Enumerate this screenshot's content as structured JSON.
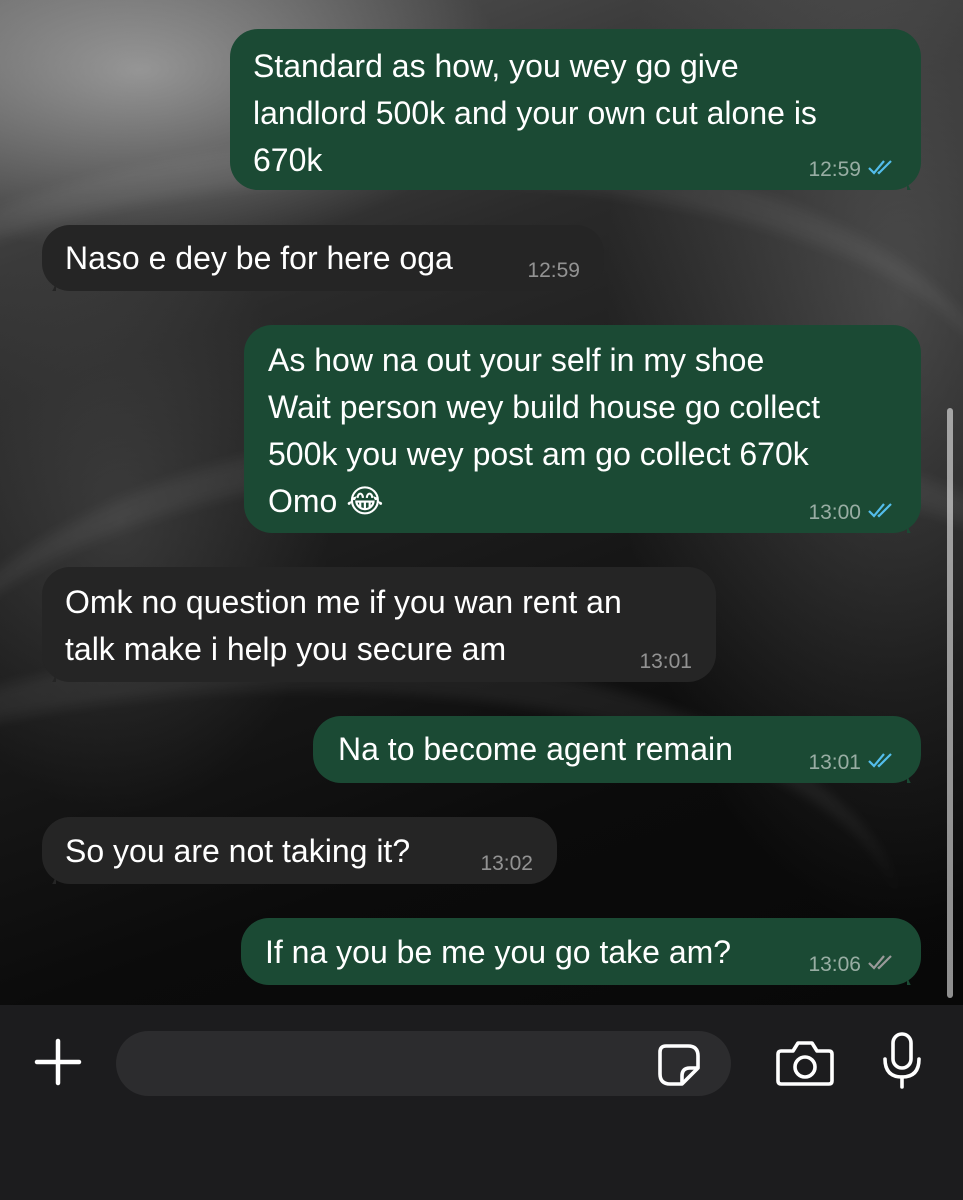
{
  "messages": [
    {
      "direction": "out",
      "text": "Standard as how, you wey go give\nlandlord 500k and your own cut alone is\n670k",
      "time": "12:59",
      "status": "read"
    },
    {
      "direction": "in",
      "text": "Naso e dey be for here oga",
      "time": "12:59"
    },
    {
      "direction": "out",
      "text": "As how na out your self in my shoe\nWait person wey build house go collect\n500k you wey post am go collect 670k\nOmo 😂",
      "time": "13:00",
      "status": "read"
    },
    {
      "direction": "in",
      "text": "Omk no question me if you wan rent an\ntalk make i help you secure am",
      "time": "13:01"
    },
    {
      "direction": "out",
      "text": "Na to become agent remain",
      "time": "13:01",
      "status": "read"
    },
    {
      "direction": "in",
      "text": "So you are not taking it?",
      "time": "13:02"
    },
    {
      "direction": "out",
      "text": "If na you be me you go take am?",
      "time": "13:06",
      "status": "delivered"
    }
  ],
  "composer": {
    "placeholder": "",
    "icons": [
      "plus-icon",
      "sticker-icon",
      "camera-icon",
      "microphone-icon"
    ]
  },
  "colors": {
    "outgoing_bubble": "#1b4a34",
    "incoming_bubble": "#252525",
    "read_tick": "#53bdeb",
    "delivered_tick": "#9a9a9a",
    "bottom_bar": "#1c1c1e"
  }
}
